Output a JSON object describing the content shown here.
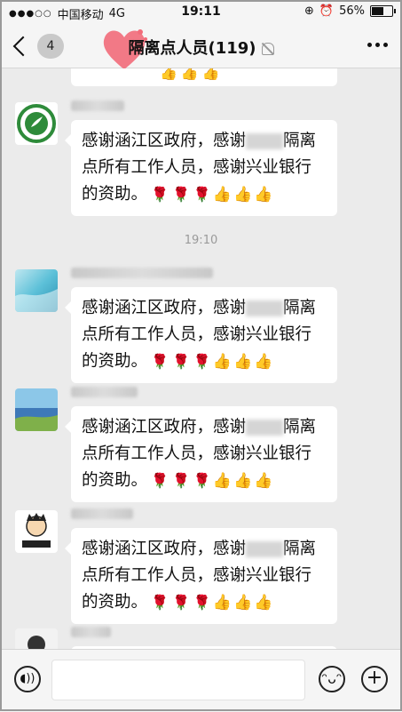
{
  "status_bar": {
    "signal": "●●●○○",
    "carrier": "中国移动",
    "network": "4G",
    "time": "19:11",
    "battery_text": "56%",
    "battery_level": 0.56
  },
  "nav": {
    "unread_count": "4",
    "title": "隔离点人员(119)"
  },
  "time_separator": "19:10",
  "message_text_part1": "感谢涵江区政府，感谢",
  "message_text_part2": "隔离点所有工作人员，感谢兴业银行的资助。",
  "emojis": {
    "rose": "🌹",
    "thumb": "👍"
  },
  "colors": {
    "background": "#ebebeb",
    "bubble": "#ffffff",
    "heart": "#f26c7a"
  }
}
